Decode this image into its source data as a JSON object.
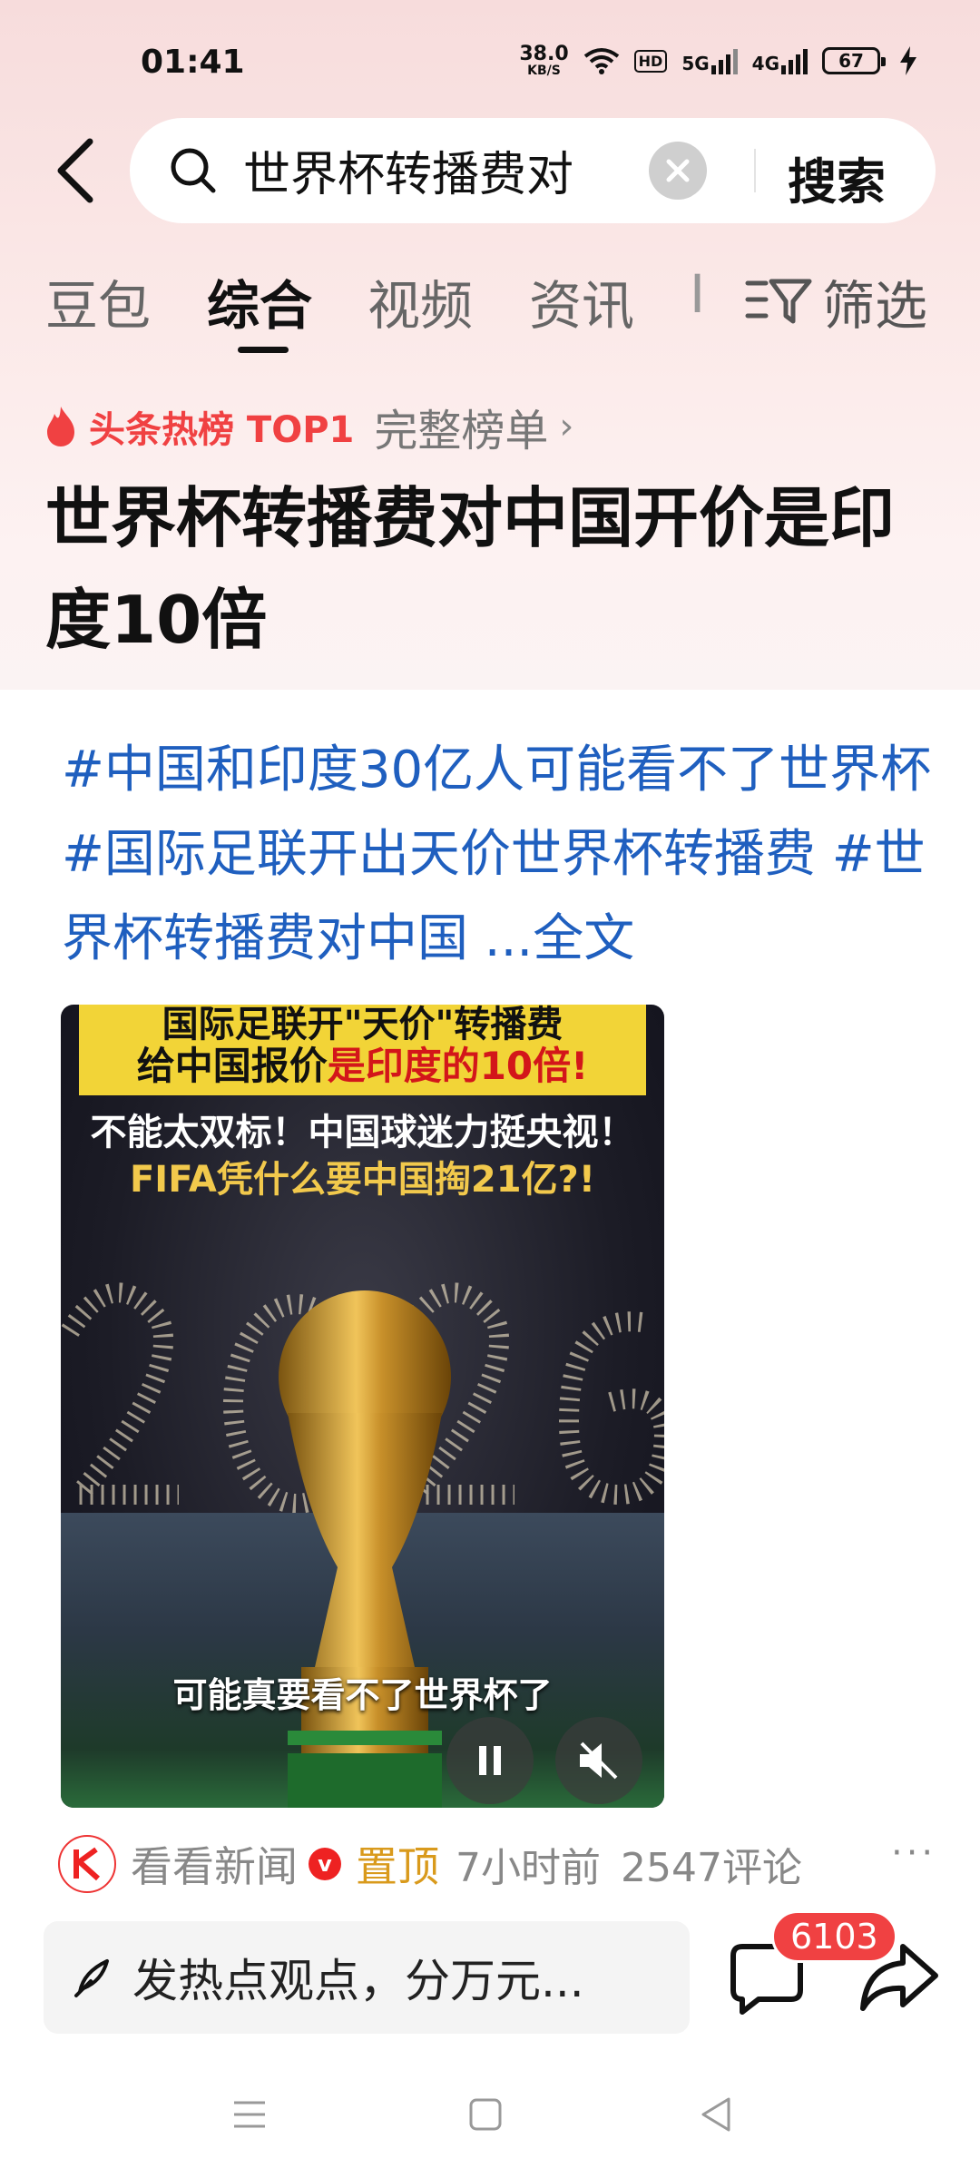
{
  "status_bar": {
    "time": "01:41",
    "net_speed": "38.0",
    "net_unit": "KB/S",
    "hd_label": "HD",
    "sig1_label": "5G",
    "sig2_label": "4G",
    "battery": "67"
  },
  "search": {
    "query": "世界杯转播费对",
    "search_button": "搜索"
  },
  "tabs": [
    {
      "label": "豆包"
    },
    {
      "label": "综合",
      "active": true
    },
    {
      "label": "视频"
    },
    {
      "label": "资讯"
    },
    {
      "label": "I"
    }
  ],
  "filter_label": "筛选",
  "hot": {
    "label": "头条热榜 TOP1",
    "full_list": "完整榜单"
  },
  "headline": "世界杯转播费对中国开价是印度10倍",
  "post": {
    "text": "#中国和印度30亿人可能看不了世界杯 #国际足联开出天价世界杯转播费 #世界杯转播费对中国 ...",
    "full_text_link": "全文",
    "media": {
      "line1": "国际足联开\"天价\"转播费",
      "line2_a": "给中国报价",
      "line2_b": "是印度的10倍!",
      "line3": "不能太双标！中国球迷力挺央视！",
      "line4": "FIFA凭什么要中国掏21亿?!",
      "caption": "可能真要看不了世界杯了"
    },
    "source": "看看新闻",
    "verified": "v",
    "pinned": "置顶",
    "time": "7小时前",
    "comments": "2547评论",
    "more": "···"
  },
  "bottom": {
    "comment_placeholder": "发热点观点，分万元...",
    "comment_count": "6103"
  },
  "colors": {
    "accent_red": "#f04142",
    "link_blue": "#1f5fbf",
    "pin_gold": "#d99a1c"
  }
}
